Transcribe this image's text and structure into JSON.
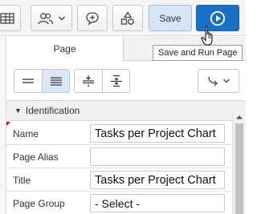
{
  "toolbar": {
    "save_label": "Save",
    "run_tooltip": "Save and Run Page"
  },
  "tabs": [
    {
      "label": "Page"
    }
  ],
  "section": {
    "title": "Identification"
  },
  "properties": [
    {
      "label": "Name",
      "value": "Tasks per Project Chart"
    },
    {
      "label": "Page Alias",
      "value": ""
    },
    {
      "label": "Title",
      "value": "Tasks per Project Chart"
    },
    {
      "label": "Page Group",
      "value": "- Select -"
    }
  ],
  "colors": {
    "run_button": "#1a70c6",
    "save_button": "#d6e6f5",
    "active_view": "#d9e7f6",
    "required_marker": "#d0021b"
  }
}
